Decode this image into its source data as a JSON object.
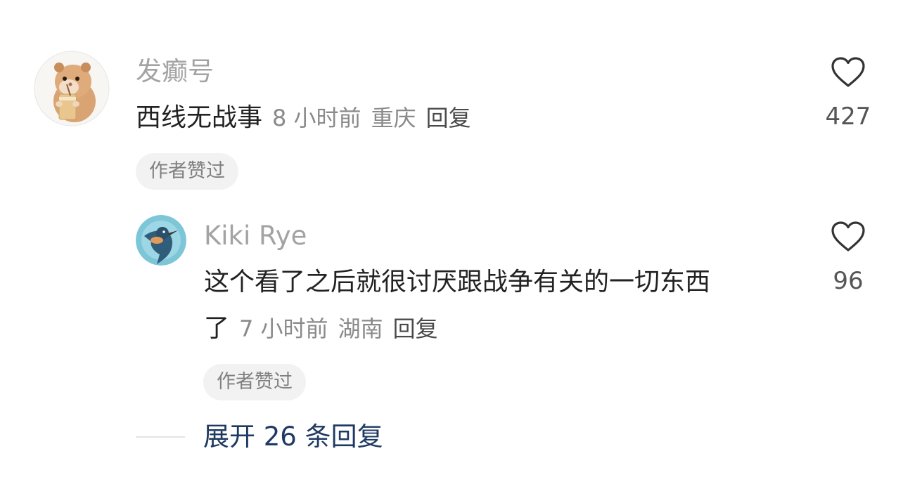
{
  "comments": [
    {
      "username": "发癫号",
      "text_line1": "西线无战事",
      "time": "8 小时前",
      "location": "重庆",
      "reply_label": "回复",
      "badge": "作者赞过",
      "likes": "427"
    },
    {
      "username": "Kiki Rye",
      "text_line1": "这个看了之后就很讨厌跟战争有关的一切东西",
      "text_line2": "了",
      "time": "7 小时前",
      "location": "湖南",
      "reply_label": "回复",
      "badge": "作者赞过",
      "likes": "96"
    }
  ],
  "expand_replies": "展开 26 条回复",
  "icons": {
    "like": "heart-outline-icon"
  },
  "colors": {
    "username": "#a3a3a3",
    "text": "#222222",
    "meta": "#8a8a8a",
    "expand_link": "#1f3a62",
    "badge_bg": "#f2f2f2"
  }
}
